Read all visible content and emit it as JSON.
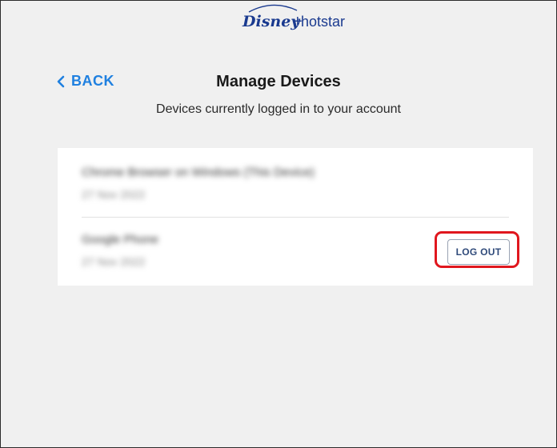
{
  "brand": {
    "logo_text_1": "Disney",
    "logo_text_2": "+",
    "logo_text_3": "hotstar",
    "color": "#1a3a8f"
  },
  "header": {
    "back_label": "BACK",
    "back_icon": "chevron-left-icon",
    "title": "Manage Devices",
    "subtitle": "Devices currently logged in to your account"
  },
  "devices": [
    {
      "name": "Chrome Browser on Windows (This Device)",
      "date": "27 Nov 2022"
    },
    {
      "name": "Google Phone",
      "date": "27 Nov 2022",
      "action_label": "LOG OUT"
    }
  ],
  "colors": {
    "accent": "#1f80e0",
    "highlight": "#e0171e",
    "background": "#f0f0f0"
  }
}
